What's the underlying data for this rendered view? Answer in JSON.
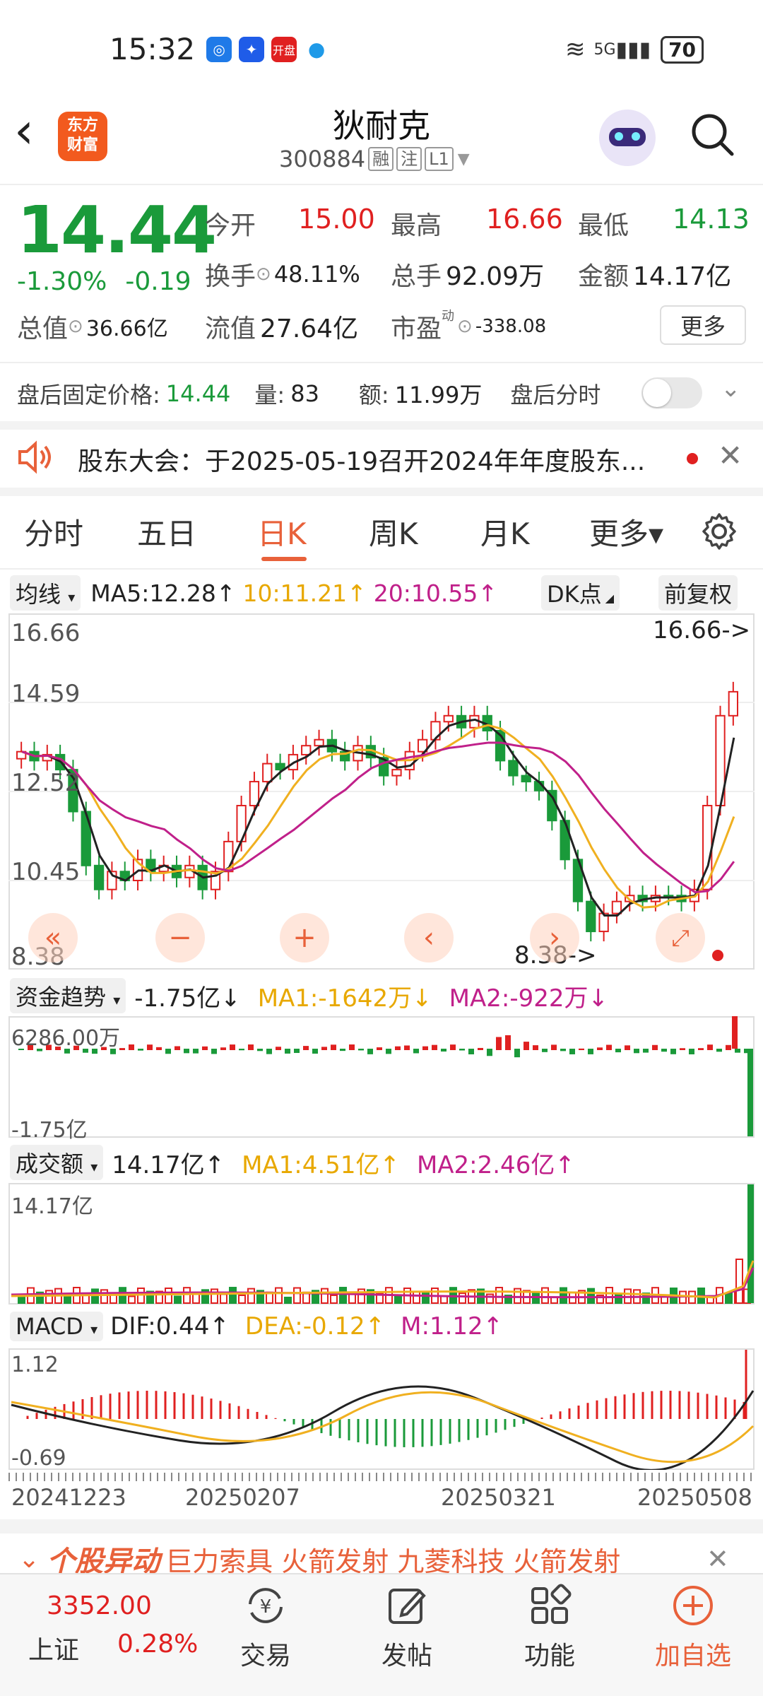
{
  "status_bar": {
    "time": "15:32",
    "signal": "5G",
    "battery": "70",
    "app_badge": "开盘"
  },
  "header": {
    "title": "狄耐克",
    "code": "300884",
    "tags": [
      "融",
      "注",
      "L1"
    ],
    "logo_line1": "东方",
    "logo_line2": "财富"
  },
  "quote": {
    "price": "14.44",
    "change_pct": "-1.30%",
    "change": "-0.19",
    "open_label": "今开",
    "open": "15.00",
    "high_label": "最高",
    "high": "16.66",
    "low_label": "最低",
    "low": "14.13",
    "turnover_label": "换手",
    "turnover": "48.11%",
    "volume_label": "总手",
    "volume": "92.09万",
    "amount_label": "金额",
    "amount": "14.17亿",
    "mktcap_label": "总值",
    "mktcap": "36.66亿",
    "float_label": "流值",
    "float": "27.64亿",
    "pe_label": "市盈",
    "pe_sup": "动",
    "pe": "-338.08",
    "more_label": "更多"
  },
  "after_hours": {
    "price_label": "盘后固定价格:",
    "price": "14.44",
    "vol_label": "量:",
    "vol": "83",
    "amt_label": "额:",
    "amt": "11.99万",
    "toggle_label": "盘后分时"
  },
  "notice": {
    "text": "股东大会：于2025-05-19召开2024年年度股东..."
  },
  "tabs": [
    {
      "label": "分时",
      "active": false
    },
    {
      "label": "五日",
      "active": false
    },
    {
      "label": "日K",
      "active": true
    },
    {
      "label": "周K",
      "active": false
    },
    {
      "label": "月K",
      "active": false
    },
    {
      "label": "更多▾",
      "active": false
    }
  ],
  "ma_bar": {
    "selector": "均线",
    "ma5": "MA5:12.28↑",
    "ma10": "10:11.21↑",
    "ma20": "20:10.55↑",
    "dk": "DK点",
    "adjust": "前复权"
  },
  "kline": {
    "y_labels": [
      "16.66",
      "14.59",
      "12.52",
      "10.45",
      "8.38"
    ],
    "max_marker": "16.66->",
    "min_marker": "8.38->",
    "colors": {
      "up": "#e02020",
      "down": "#1a9a3a",
      "ma5": "#222222",
      "ma10": "#f0b020",
      "ma20": "#c0208a"
    }
  },
  "fund_flow": {
    "selector": "资金趋势",
    "value": "-1.75亿↓",
    "ma1": "MA1:-1642万↓",
    "ma2": "MA2:-922万↓",
    "top": "6286.00万",
    "bottom": "-1.75亿"
  },
  "turnover_panel": {
    "selector": "成交额",
    "value": "14.17亿↑",
    "ma1": "MA1:4.51亿↑",
    "ma2": "MA2:2.46亿↑",
    "top": "14.17亿"
  },
  "macd": {
    "selector": "MACD",
    "dif": "DIF:0.44↑",
    "dea": "DEA:-0.12↑",
    "m": "M:1.12↑",
    "top": "1.12",
    "bottom": "-0.69"
  },
  "dates": [
    "20241223",
    "20250207",
    "20250321",
    "20250508"
  ],
  "ticker": {
    "title": "个股异动",
    "text": "巨力索具 火箭发射 九菱科技 火箭发射"
  },
  "bottom_nav": {
    "index_value": "3352.00",
    "index_name": "上证",
    "index_change": "0.28%",
    "items": [
      "交易",
      "发帖",
      "功能",
      "加自选"
    ]
  }
}
